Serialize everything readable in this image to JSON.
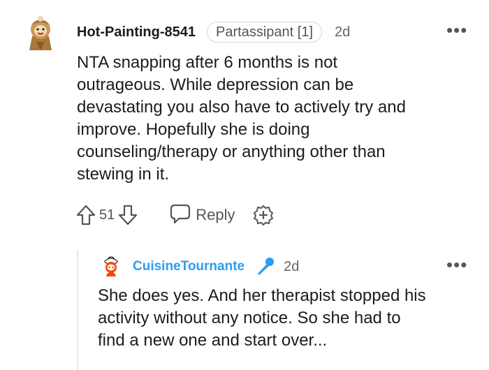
{
  "comment": {
    "username": "Hot-Painting-8541",
    "flair": "Partassipant [1]",
    "time": "2d",
    "more_label": "•••",
    "body_lines": [
      "NTA snapping after 6 months is not",
      "outrageous. While depression can be",
      "devastating you also have to actively try and",
      "improve. Hopefully she is doing",
      "counseling/therapy or anything other than",
      "stewing in it."
    ],
    "score": "51",
    "reply_label": "Reply"
  },
  "reply": {
    "username": "CuisineTournante",
    "time": "2d",
    "more_label": "•••",
    "body_lines": [
      "She does yes. And her therapist stopped his",
      "activity without any notice. So she had to",
      "find a new one and start over..."
    ]
  },
  "colors": {
    "accent_blue": "#2a9df4",
    "avatar_orange": "#ff4500",
    "text": "#1c1c1c",
    "muted": "#555555"
  },
  "icons": {
    "upvote": "upvote-arrow-icon",
    "downvote": "downvote-arrow-icon",
    "reply": "speech-bubble-icon",
    "award": "plus-circle-icon",
    "mic": "microphone-icon"
  }
}
